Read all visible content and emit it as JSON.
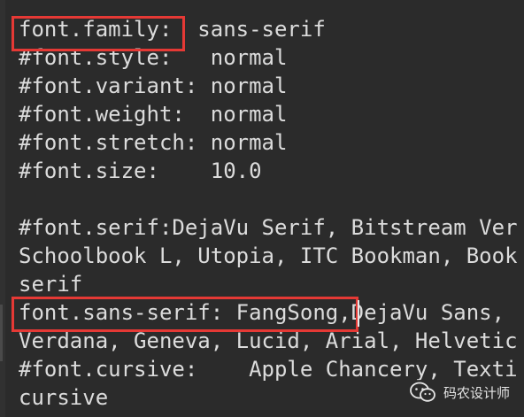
{
  "editor": {
    "lines": [
      "font.family:  sans-serif",
      "#font.style:   normal",
      "#font.variant: normal",
      "#font.weight:  normal",
      "#font.stretch: normal",
      "#font.size:    10.0",
      "",
      "#font.serif:DejaVu Serif, Bitstream Ver",
      "Schoolbook L, Utopia, ITC Bookman, Book",
      "serif",
      "font.sans-serif: FangSong,DejaVu Sans, ",
      "Verdana, Geneva, Lucid, Arial, Helvetic",
      "#font.cursive:    Apple Chancery, Texti",
      "cursive"
    ]
  },
  "watermark": {
    "text": "码农设计师",
    "icon": "wechat-logo-icon"
  },
  "colors": {
    "background": "#2b2b2b",
    "text": "#dcdcdc",
    "highlight_box": "#e53935"
  }
}
